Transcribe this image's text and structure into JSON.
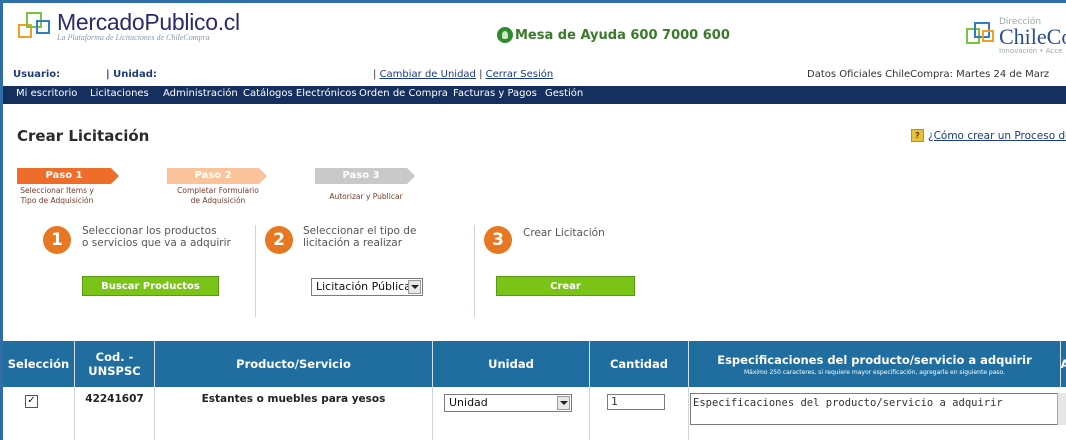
{
  "header": {
    "logo_title": "MercadoPublico.cl",
    "logo_tagline": "La Plataforma de Licitaciones de ChileCompra",
    "help_text": "Mesa de Ayuda 600 7000 600",
    "cc_small": "Dirección",
    "cc_big": "ChileCo",
    "cc_sub": "Innovación • Acce"
  },
  "userbar": {
    "usuario_label": "Usuario:",
    "unidad_label": "| Unidad:",
    "sep": "|",
    "cambiar": "Cambiar de Unidad",
    "cerrar": "Cerrar Sesión",
    "oficial": "Datos Oficiales ChileCompra: Martes 24 de Marz"
  },
  "nav": [
    "Mi escritorio",
    "Licitaciones",
    "Administración",
    "Catálogos Electrónicos",
    "Orden de Compra",
    "Facturas y Pagos",
    "Gestión"
  ],
  "page": {
    "title": "Crear Licitación",
    "howto_icon": "?",
    "howto": "¿Cómo crear un Proceso de"
  },
  "steps": [
    {
      "label": "Paso 1",
      "sub1": "Seleccionar Items y",
      "sub2": "Tipo de Adquisición"
    },
    {
      "label": "Paso 2",
      "sub1": "Completar Formulario",
      "sub2": "de Adquisición"
    },
    {
      "label": "Paso 3",
      "sub1": "Autorizar y Publicar",
      "sub2": ""
    }
  ],
  "actions": [
    {
      "num": "1",
      "line1": "Seleccionar los productos",
      "line2": "o servicios que va a adquirir",
      "button": "Buscar Productos"
    },
    {
      "num": "2",
      "line1": "Seleccionar el tipo de",
      "line2": "licitación a realizar",
      "select": "Licitación Pública"
    },
    {
      "num": "3",
      "line1": "Crear Licitación",
      "line2": "",
      "button": "Crear"
    }
  ],
  "table": {
    "headers": [
      "Selección",
      "Cod. -UNSPSC",
      "Producto/Servicio",
      "Unidad",
      "Cantidad",
      "Especificaciones del producto/servicio a adquirir",
      "A"
    ],
    "spec_note": "Máximo 250 caracteres, si requiere mayor especificación, agregarla en siguiente paso.",
    "row": {
      "check": "✓",
      "code": "42241607",
      "product": "Estantes o muebles para yesos",
      "unidad": "Unidad",
      "cantidad": "1",
      "spec": "Especificaciones del producto/servicio a adquirir"
    }
  }
}
